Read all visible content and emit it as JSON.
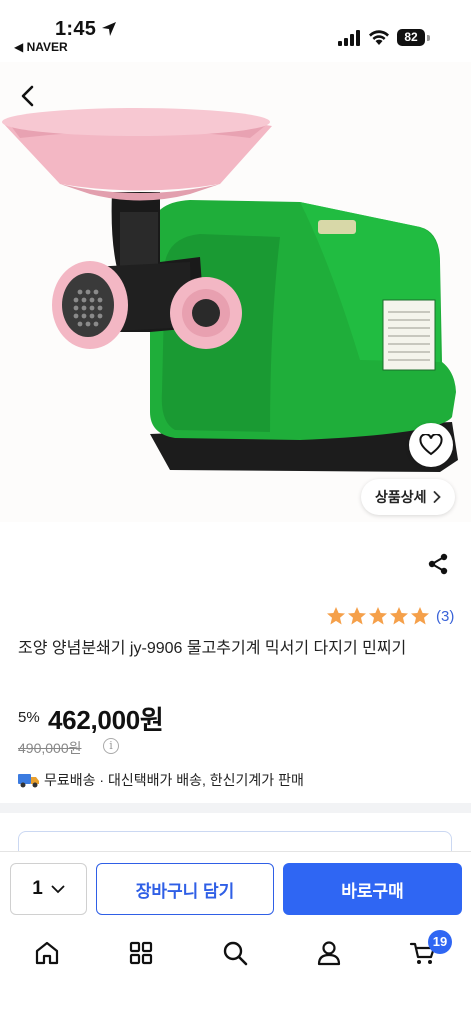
{
  "status_bar": {
    "time": "1:45",
    "back_app": "◀ NAVER",
    "battery": "82"
  },
  "hero": {
    "image_alt": "meat grinder product photo",
    "detail_label": "상품상세"
  },
  "product": {
    "rating": 5,
    "review_count": "(3)",
    "title": "조양 양념분쇄기 jy-9906 물고추기계 믹서기 다지기 민찌기",
    "discount": "5%",
    "price": "462,000원",
    "original_price": "490,000원",
    "shipping": "무료배송 · 대신택배가 배송, 한신기계가 판매"
  },
  "purchase": {
    "quantity": "1",
    "cart_label": "장바구니 담기",
    "buy_label": "바로구매"
  },
  "tabs": {
    "cart_badge": "19"
  },
  "colors": {
    "accent": "#2f66f3",
    "star": "#f5a04a",
    "machine_green": "#1fae3a",
    "pink": "#f3b7c4"
  }
}
